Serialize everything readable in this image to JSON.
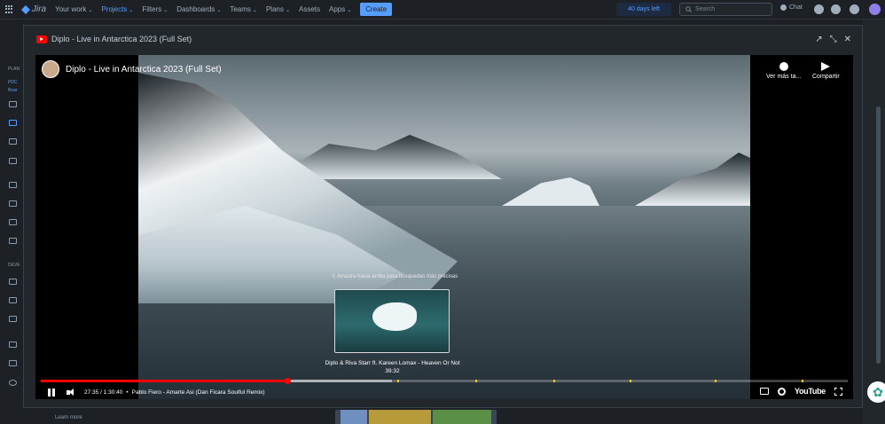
{
  "topnav": {
    "app_name": "Jira",
    "items": [
      {
        "label": "Your work",
        "chevron": "⌄",
        "active": false
      },
      {
        "label": "Projects",
        "chevron": "⌄",
        "active": true
      },
      {
        "label": "Filters",
        "chevron": "⌄",
        "active": false
      },
      {
        "label": "Dashboards",
        "chevron": "⌄",
        "active": false
      },
      {
        "label": "Teams",
        "chevron": "⌄",
        "active": false
      },
      {
        "label": "Plans",
        "chevron": "⌄",
        "active": false
      },
      {
        "label": "Assets",
        "chevron": "",
        "active": false
      },
      {
        "label": "Apps",
        "chevron": "⌄",
        "active": false
      }
    ],
    "create_label": "Create",
    "trial_label": "40 days left",
    "search_placeholder": "Search",
    "chat_label": "Chat"
  },
  "sidebar": {
    "planning_label": "PLAN",
    "project_link": "PDC",
    "board_link": "Boar",
    "development_label": "DEVE"
  },
  "footer": {
    "learn_more": "Learn more"
  },
  "modal": {
    "title": "Diplo - Live in Antarctica 2023 (Full Set)",
    "open_icon": "↗",
    "minimize_icon": "⤡",
    "close_icon": "✕"
  },
  "player": {
    "video_title": "Diplo - Live in Antarctica 2023 (Full Set)",
    "watch_later_label": "Ver más ta...",
    "share_label": "Compartir",
    "drag_hint": "⇳ Arrastra hacia arriba para búsquedas más precisas",
    "preview_title": "Diplo & Riva Starr ft. Kareen Lomax - Heaven Or Not",
    "preview_time": "39:32",
    "current_time": "27:35 / 1:30:40",
    "separator": "•",
    "chapter": "Pablo Fiero - Amarte Asi (Dan Ficara Soulful Remix)",
    "youtube_label": "YouTube",
    "progress_played": 0.305,
    "progress_buffered": 0.435
  },
  "colors": {
    "accent": "#579dff",
    "youtube_red": "#ff0000",
    "background": "#1d2125"
  }
}
